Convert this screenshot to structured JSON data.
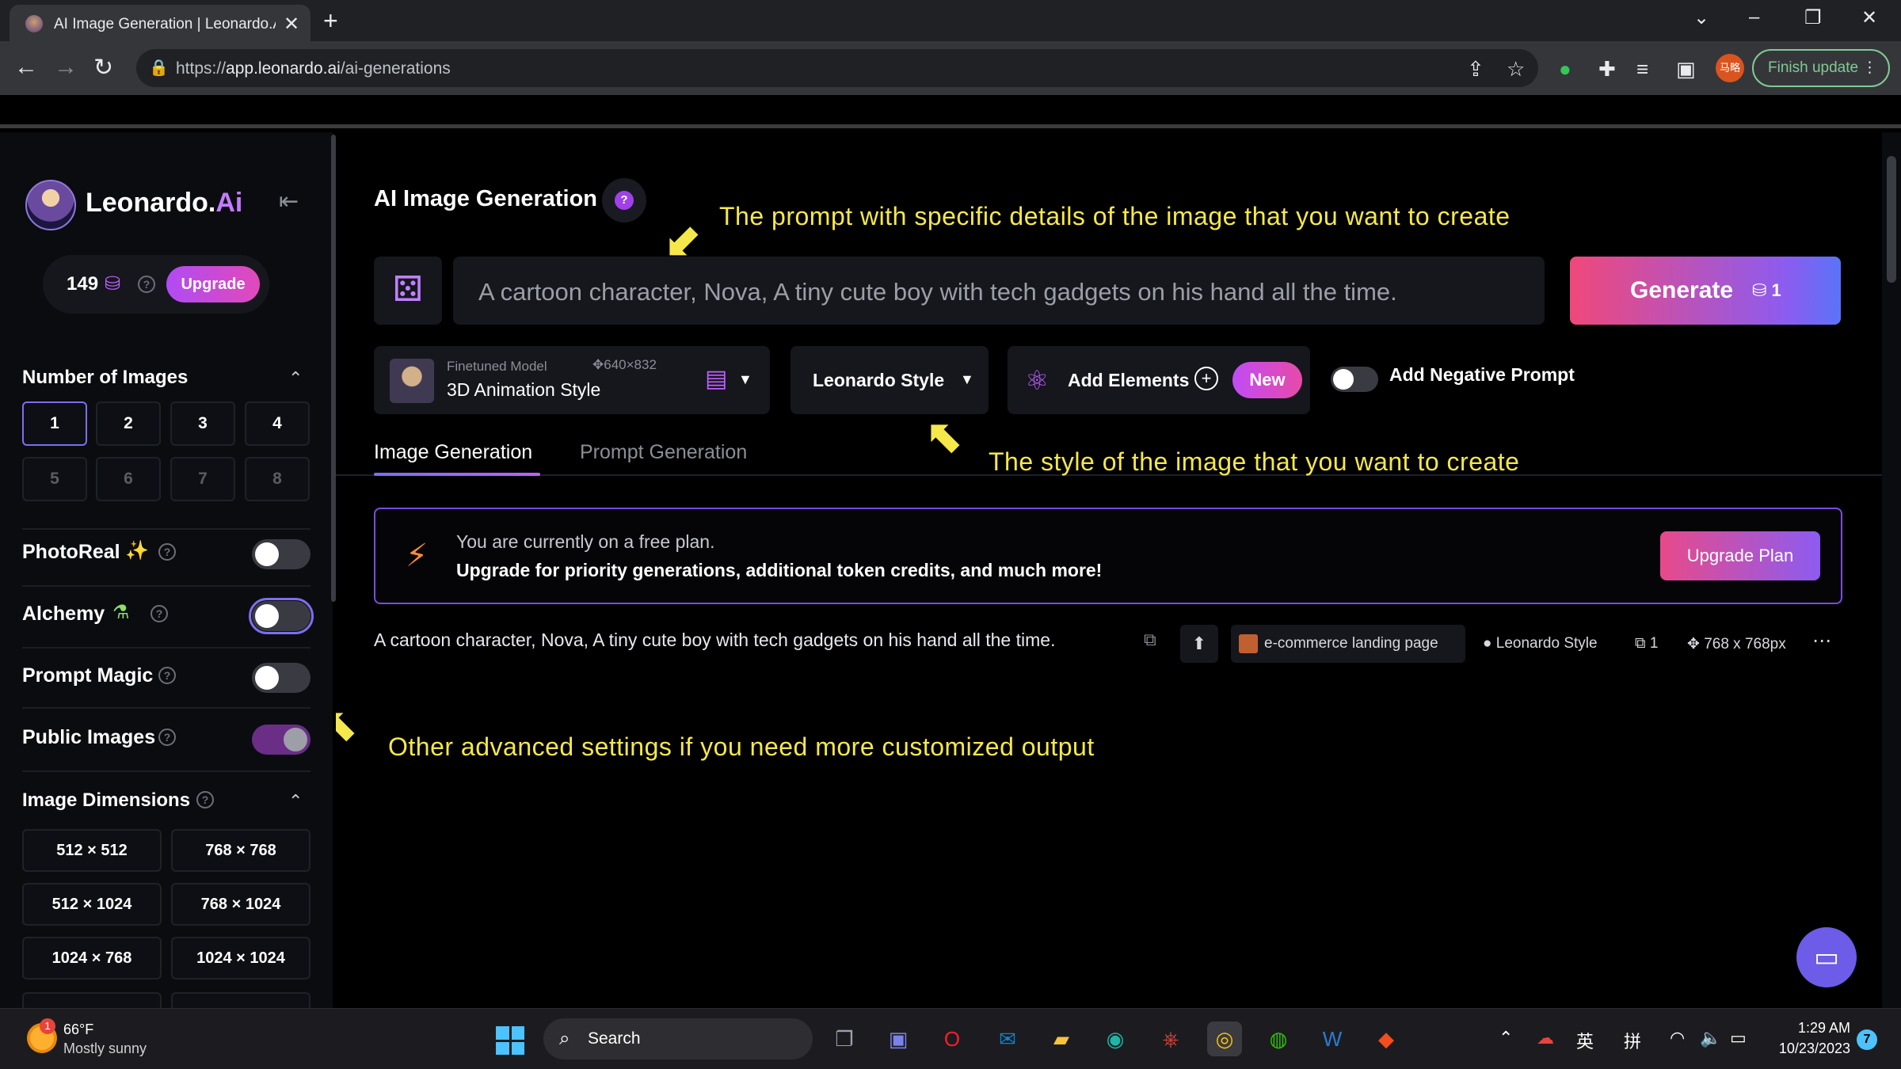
{
  "browser": {
    "tab_title": "AI Image Generation | Leonardo.Ai",
    "url_prefix": "https://",
    "url_host": "app.leonardo.ai",
    "url_path": "/ai-generations",
    "finish_update_label": "Finish update",
    "profile_text": "马略"
  },
  "sidebar": {
    "brand": "Leonardo.",
    "brand_accent": "Ai",
    "credits": "149",
    "upgrade_label": "Upgrade",
    "number_of_images": {
      "title": "Number of Images",
      "options": [
        "1",
        "2",
        "3",
        "4",
        "5",
        "6",
        "7",
        "8"
      ],
      "selected": "1"
    },
    "settings": [
      {
        "label": "PhotoReal",
        "icon": "camera-sparkle-icon",
        "on": false
      },
      {
        "label": "Alchemy",
        "icon": "flask-icon",
        "on": false
      },
      {
        "label": "Prompt Magic",
        "icon": "",
        "on": false
      },
      {
        "label": "Public Images",
        "icon": "",
        "on": true
      }
    ],
    "image_dimensions": {
      "title": "Image Dimensions",
      "options": [
        "512 × 512",
        "768 × 768",
        "512 × 1024",
        "768 × 1024",
        "1024 × 768",
        "1024 × 1024"
      ]
    }
  },
  "main": {
    "title": "AI Image Generation",
    "prompt": "A cartoon character, Nova, A tiny cute boy with tech gadgets on his hand all the time.",
    "generate_label": "Generate",
    "generate_cost": "1",
    "model": {
      "sub": "Finetuned Model",
      "dims": "640×832",
      "name": "3D Animation Style"
    },
    "style_label": "Leonardo Style",
    "elements_label": "Add Elements",
    "new_badge": "New",
    "negative_prompt_label": "Add Negative Prompt",
    "tabs": [
      "Image Generation",
      "Prompt Generation"
    ],
    "banner": {
      "line1": "You are currently on a free plan.",
      "line2": "Upgrade for priority generations, additional token credits, and much more!",
      "button": "Upgrade Plan"
    },
    "history": {
      "prompt": "A cartoon character, Nova, A tiny cute boy with tech gadgets on his hand all the time.",
      "model_chip": "e-commerce landing page",
      "style": "Leonardo Style",
      "count": "1",
      "size": "768 x 768px"
    }
  },
  "annotations": {
    "prompt": "The prompt with specific details of the image that you want to create",
    "style": "The style of the image that you want to create",
    "advanced": "Other advanced settings if you need more customized output"
  },
  "taskbar": {
    "temp": "66°F",
    "weather": "Mostly sunny",
    "weather_badge": "1",
    "search_label": "Search",
    "ime1": "英",
    "ime2": "拼",
    "time": "1:29 AM",
    "date": "10/23/2023",
    "notifications": "7"
  }
}
